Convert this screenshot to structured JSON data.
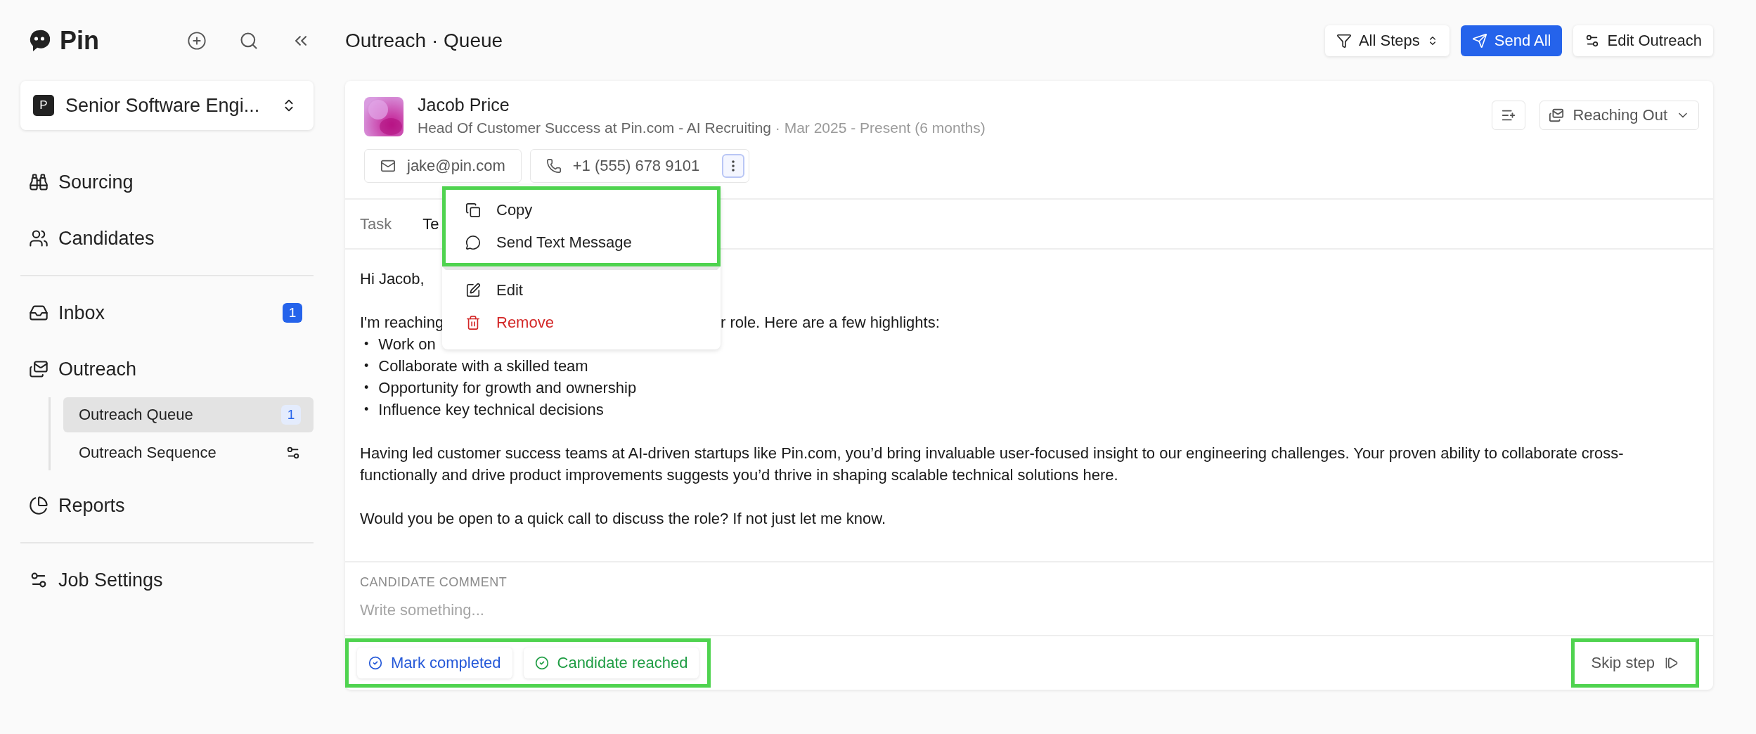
{
  "sidebar": {
    "logo": "Pin",
    "job": {
      "badge": "P",
      "title": "Senior Software Engi..."
    },
    "groups": [
      {
        "items": [
          {
            "label": "Sourcing",
            "selected": false
          },
          {
            "label": "Candidates",
            "selected": false
          }
        ]
      },
      {
        "items": [
          {
            "label": "Inbox",
            "selected": false,
            "badge": "1"
          },
          {
            "label": "Outreach",
            "selected": false,
            "expanded": true,
            "children": [
              {
                "label": "Outreach Queue",
                "selected": true,
                "badge": "1"
              },
              {
                "label": "Outreach Sequence",
                "selected": false
              }
            ]
          },
          {
            "label": "Reports",
            "selected": false
          }
        ]
      },
      {
        "items": [
          {
            "label": "Job Settings",
            "selected": false
          }
        ]
      }
    ]
  },
  "header": {
    "title": "Outreach · Queue",
    "buttons": [
      {
        "label": "All Steps",
        "kind": "filter"
      },
      {
        "label": "Send All",
        "kind": "primary"
      },
      {
        "label": "Edit Outreach",
        "kind": "settings"
      }
    ]
  },
  "candidate": {
    "name": "Jacob Price",
    "role": "Head Of Customer Success at Pin.com - AI Recruiting",
    "tenure": " · Mar 2025 - Present (6 months)",
    "status": "Reaching Out",
    "contacts": [
      {
        "kind": "email",
        "value": "jake@pin.com"
      },
      {
        "kind": "phone",
        "value": "+1 (555) 678 9101",
        "menu_open": true
      }
    ]
  },
  "tabs": [
    {
      "label": "Task",
      "selected": false
    },
    {
      "label": "Te",
      "selected": true
    }
  ],
  "message": {
    "greeting": "Hi Jacob,",
    "intro": [
      "I'm reaching",
      "r role. Here are a few highlights:"
    ],
    "bullets": [
      {
        "marker": "•",
        "text": "Work on"
      },
      {
        "marker": "•",
        "text": "Collaborate with a skilled team"
      },
      {
        "marker": "•",
        "text": "Opportunity for growth and ownership"
      },
      {
        "marker": "•",
        "text": "Influence key technical decisions"
      }
    ],
    "paragraphs": [
      "Having led customer success teams at AI-driven startups like Pin.com, you’d bring invaluable user-focused insight to our engineering challenges. Your proven ability to collaborate cross-functionally and drive product improvements suggests you’d thrive in shaping scalable technical solutions here.",
      "Would you be open to a quick call to discuss the role? If not just let me know."
    ]
  },
  "comment": {
    "label": "CANDIDATE COMMENT",
    "placeholder": "Write something..."
  },
  "menu": {
    "sections": [
      {
        "highlighted": true,
        "items": [
          {
            "label": "Copy",
            "kind": "copy"
          },
          {
            "label": "Send Text Message",
            "kind": "message"
          }
        ]
      },
      {
        "highlighted": false,
        "items": [
          {
            "label": "Edit",
            "kind": "edit"
          },
          {
            "label": "Remove",
            "kind": "danger"
          }
        ]
      }
    ]
  },
  "footer": {
    "actions_highlighted": true,
    "actions": [
      {
        "label": "Mark completed",
        "kind": "primary"
      },
      {
        "label": "Candidate reached",
        "kind": "success"
      }
    ],
    "skip": {
      "label": "Skip step",
      "highlighted": true
    }
  }
}
